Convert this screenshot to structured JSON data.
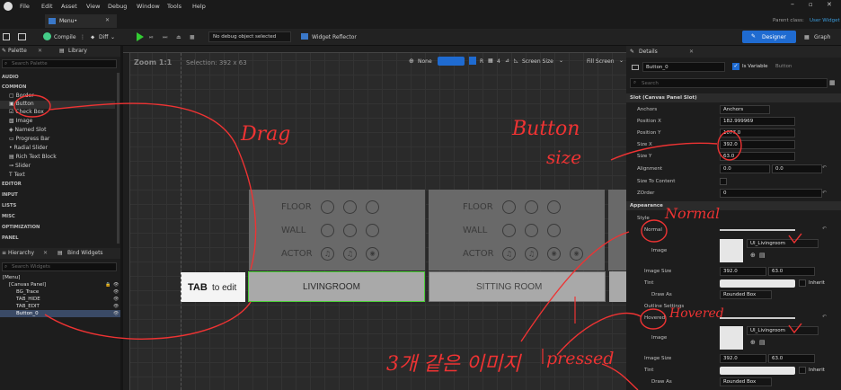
{
  "menu": [
    "File",
    "Edit",
    "Asset",
    "View",
    "Debug",
    "Window",
    "Tools",
    "Help"
  ],
  "tab": {
    "label": "Menu•",
    "parent_class": "Parent class:",
    "parent_value": "User Widget"
  },
  "toolbar": {
    "compile": "Compile",
    "diff": "Diff",
    "debug": "No debug object selected",
    "reflector": "Widget Reflector",
    "designer": "Designer",
    "graph": "Graph"
  },
  "palette": {
    "title": "Palette",
    "library": "Library",
    "search": "Search Palette",
    "cats": [
      "AUDIO",
      "COMMON",
      "EDITOR",
      "INPUT",
      "LISTS",
      "MISC",
      "OPTIMIZATION",
      "PANEL"
    ],
    "items": [
      "Border",
      "Button",
      "Check Box",
      "Image",
      "Named Slot",
      "Progress Bar",
      "Radial Slider",
      "Rich Text Block",
      "Slider",
      "Text"
    ]
  },
  "hierarchy": {
    "title": "Hierarchy",
    "bind": "Bind Widgets",
    "search": "Search Widgets",
    "items": [
      "[Menu]",
      "[Canvas Panel]",
      "BG_Trace",
      "TAB_HIDE",
      "TAB_EDIT",
      "Button_0"
    ]
  },
  "designer": {
    "zoom": "Zoom 1:1",
    "selection": "Selection: 392 x 63",
    "none": "None",
    "r": "R",
    "four": "4",
    "screen_size": "Screen Size",
    "fill_screen": "Fill Screen",
    "floor": "FLOOR",
    "wall": "WALL",
    "actor": "ACTOR",
    "livingroom": "LIVINGROOM",
    "sitting": "SITTING ROOM",
    "tab_bold": "TAB",
    "tab_rest": "to edit"
  },
  "details": {
    "title": "Details",
    "name": "Button_0",
    "is_variable": "Is Variable",
    "button": "Button",
    "search": "Search",
    "slot": "Slot (Canvas Panel Slot)",
    "anchors": "Anchors",
    "anchors_val": "Anchors",
    "pos_x": "Position X",
    "pos_x_val": "182.999969",
    "pos_y": "Position Y",
    "pos_y_val": "1077.0",
    "size_x": "Size X",
    "size_x_val": "392.0",
    "size_y": "Size Y",
    "size_y_val": "63.0",
    "alignment": "Alignment",
    "align_a": "0.0",
    "align_b": "0.0",
    "size_to_content": "Size To Content",
    "zorder": "ZOrder",
    "zorder_val": "0",
    "appearance": "Appearance",
    "style": "Style",
    "normal": "Normal",
    "image": "Image",
    "image_val": "UI_Livingroom",
    "image_size": "Image Size",
    "is_a": "392.0",
    "is_b": "63.0",
    "tint": "Tint",
    "inherit": "Inherit",
    "draw_as": "Draw As",
    "draw_val": "Rounded Box",
    "outline": "Outline Settings",
    "hovered": "Hovered"
  },
  "annotations": {
    "drag": "Drag",
    "button": "Button",
    "size": "size",
    "normal": "Normal",
    "hovered": "Hovered",
    "same": "3개 같은 이미지",
    "pressed": "pressed"
  }
}
